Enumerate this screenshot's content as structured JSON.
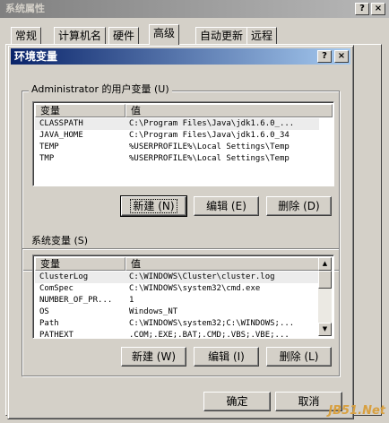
{
  "sysprops": {
    "title": "系统属性",
    "help_glyph": "?",
    "close_glyph": "×",
    "tabs": [
      "常规",
      "计算机名",
      "硬件",
      "高级",
      "自动更新",
      "远程"
    ]
  },
  "env": {
    "title": "环境变量",
    "help_glyph": "?",
    "close_glyph": "×",
    "user_group_label": "Administrator 的用户变量 (U)",
    "system_group_label": "系统变量 (S)",
    "columns": [
      "变量",
      "值"
    ],
    "user_vars": [
      {
        "name": "CLASSPATH",
        "value": "C:\\Program Files\\Java\\jdk1.6.0_..."
      },
      {
        "name": "JAVA_HOME",
        "value": "C:\\Program Files\\Java\\jdk1.6.0_34"
      },
      {
        "name": "TEMP",
        "value": "%USERPROFILE%\\Local Settings\\Temp"
      },
      {
        "name": "TMP",
        "value": "%USERPROFILE%\\Local Settings\\Temp"
      }
    ],
    "system_vars": [
      {
        "name": "ClusterLog",
        "value": "C:\\WINDOWS\\Cluster\\cluster.log"
      },
      {
        "name": "ComSpec",
        "value": "C:\\WINDOWS\\system32\\cmd.exe"
      },
      {
        "name": "NUMBER_OF_PR...",
        "value": "1"
      },
      {
        "name": "OS",
        "value": "Windows_NT"
      },
      {
        "name": "Path",
        "value": "C:\\WINDOWS\\system32;C:\\WINDOWS;..."
      },
      {
        "name": "PATHEXT",
        "value": ".COM;.EXE;.BAT;.CMD;.VBS;.VBE;..."
      }
    ],
    "user_buttons": {
      "new": "新建 (N)",
      "edit": "编辑 (E)",
      "delete": "删除 (D)"
    },
    "system_buttons": {
      "new": "新建 (W)",
      "edit": "编辑 (I)",
      "delete": "删除 (L)"
    },
    "ok": "确定",
    "cancel": "取消"
  },
  "watermark": "JB51.Net",
  "icons": {
    "scroll_up": "up-arrow-icon",
    "scroll_down": "down-arrow-icon"
  },
  "colors": {
    "active_title_start": "#0a246a",
    "active_title_end": "#a6caf0",
    "inactive_title": "#808080"
  }
}
